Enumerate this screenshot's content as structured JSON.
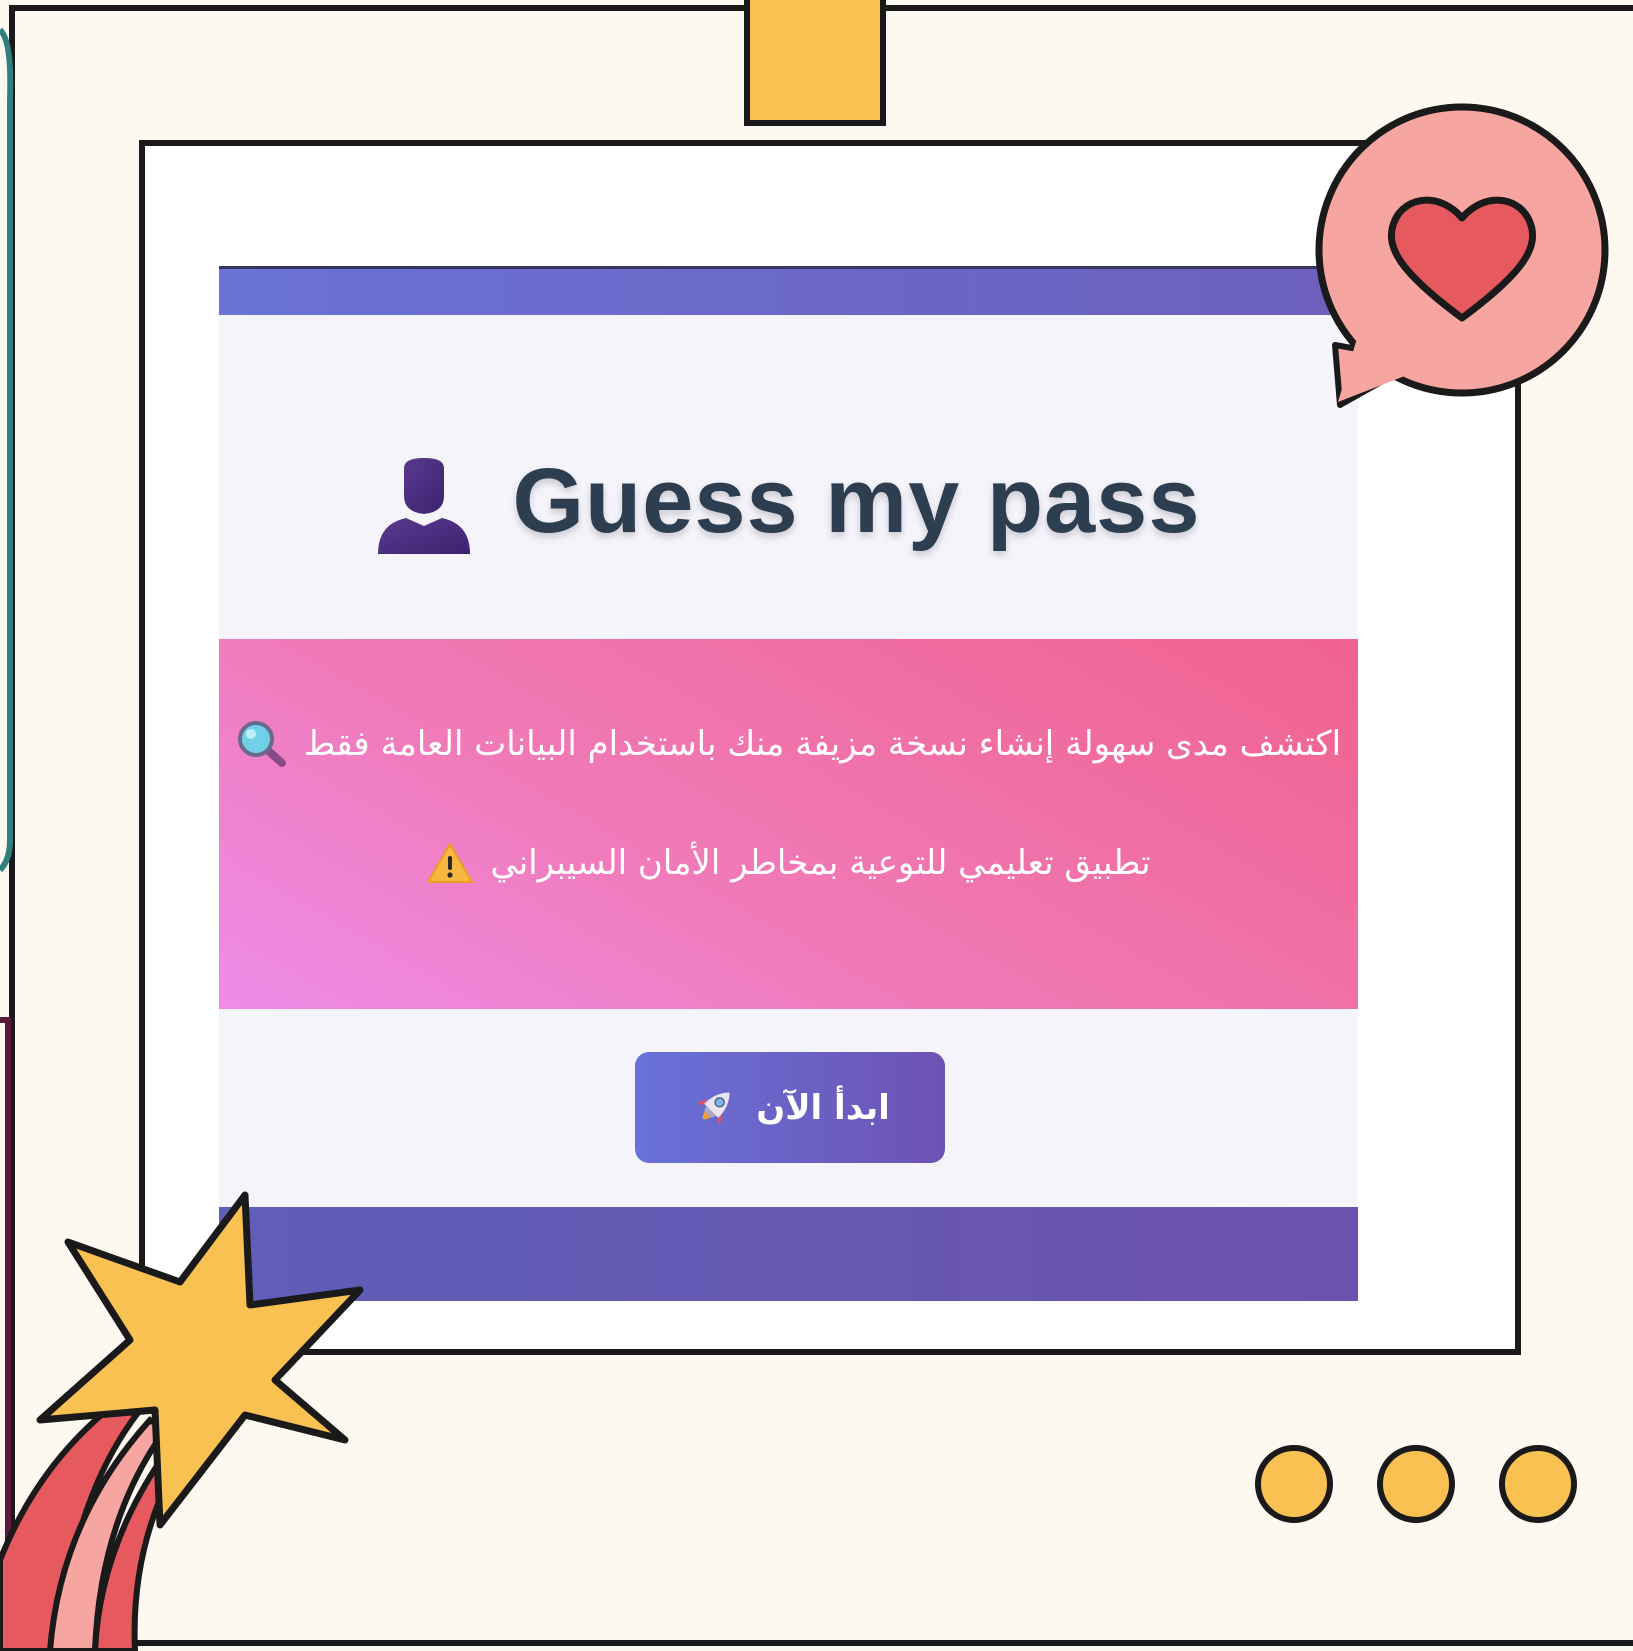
{
  "app": {
    "title": "Guess my pass",
    "title_icon": "user-silhouette-icon"
  },
  "hero": {
    "line1": "اكتشف مدى سهولة إنشاء نسخة مزيفة منك باستخدام البيانات العامة فقط",
    "line1_icon": "magnifying-glass-icon",
    "line2": "تطبيق تعليمي للتوعية بمخاطر الأمان السيبراني",
    "line2_icon": "warning-icon"
  },
  "start_button": {
    "label": "ابدأ الآن",
    "icon": "rocket-icon"
  },
  "decorations": {
    "icons": [
      "heart-speech-bubble-icon",
      "star-icon",
      "dots-icon",
      "clip-tab-icon"
    ]
  },
  "colors": {
    "page_background": "#fdf8f0",
    "title": "#2c3e50",
    "accent_purple": "#6a72d6",
    "hero_pink": "#f07ab8",
    "hero_red": "#f0628f",
    "star_yellow": "#f9c152",
    "heart_red": "#e65a5f",
    "bubble_pink": "#f7a5a1"
  }
}
